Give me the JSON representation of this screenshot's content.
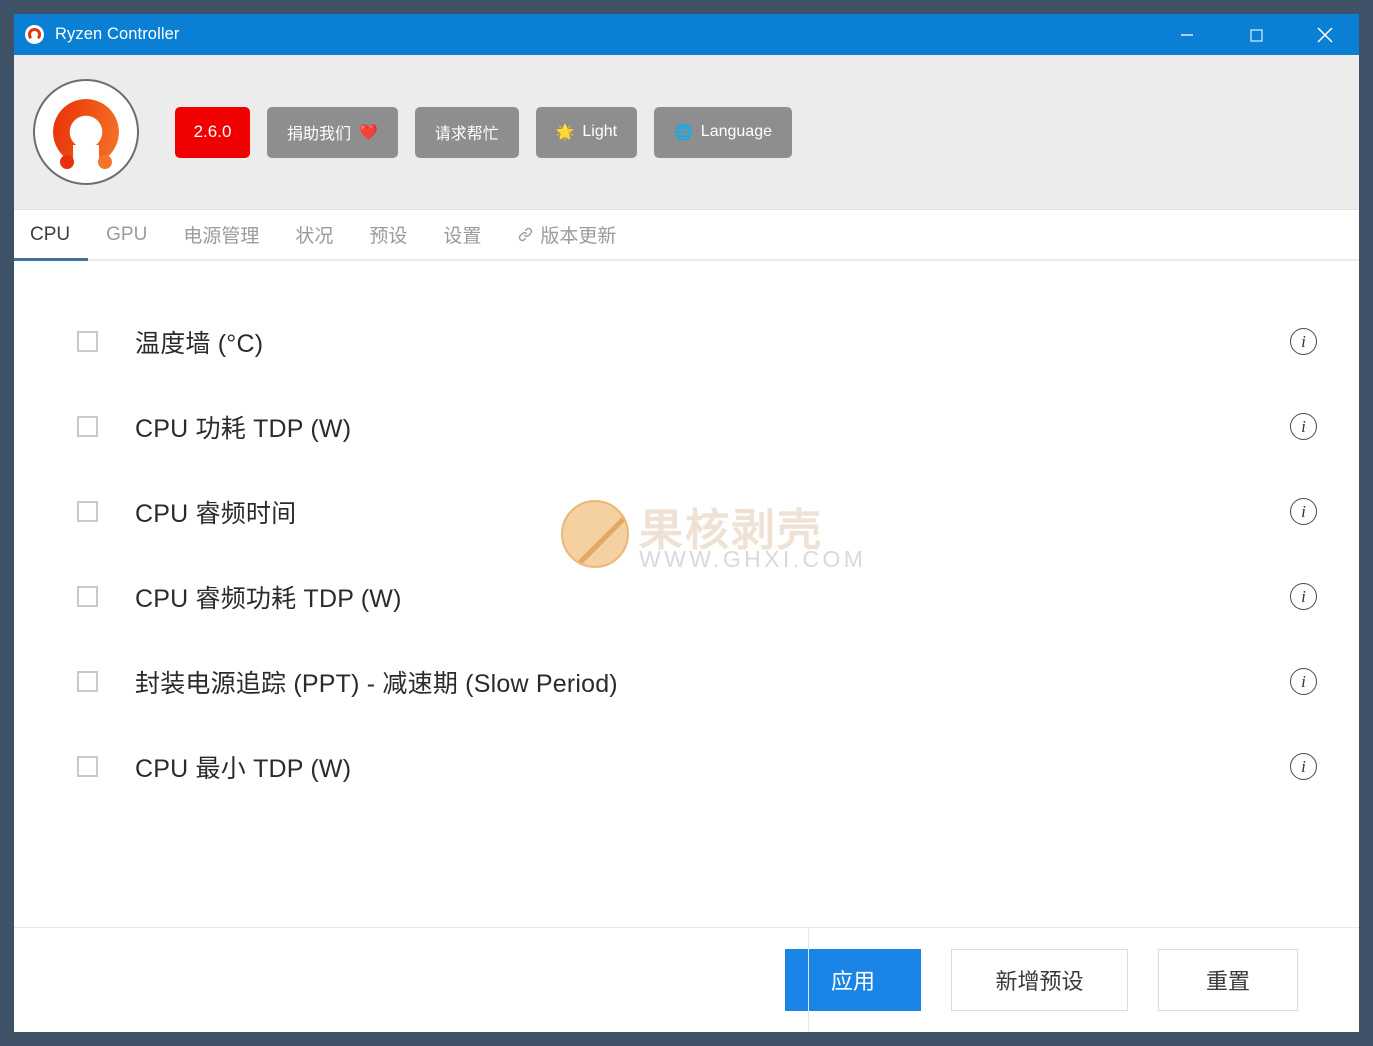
{
  "window": {
    "title": "Ryzen Controller",
    "titlebar_color": "#0a7fd4",
    "frame_color": "#3f5166",
    "controls": {
      "minimize": "minimize-icon",
      "maximize": "maximize-icon",
      "close": "close-icon"
    }
  },
  "header": {
    "logo": "ryzen-controller-logo",
    "version_badge": "2.6.0",
    "version_badge_color": "#f00000",
    "buttons": [
      {
        "label": "捐助我们",
        "icon": "❤️",
        "icon_name": "heart-icon"
      },
      {
        "label": "请求帮忙",
        "icon": "",
        "icon_name": ""
      },
      {
        "label": "Light",
        "icon": "🌟",
        "icon_name": "sun-icon"
      },
      {
        "label": "Language",
        "icon": "🌐",
        "icon_name": "globe-icon"
      }
    ]
  },
  "tabs": [
    {
      "label": "CPU",
      "active": true,
      "icon": ""
    },
    {
      "label": "GPU",
      "active": false,
      "icon": ""
    },
    {
      "label": "电源管理",
      "active": false,
      "icon": ""
    },
    {
      "label": "状况",
      "active": false,
      "icon": ""
    },
    {
      "label": "预设",
      "active": false,
      "icon": ""
    },
    {
      "label": "设置",
      "active": false,
      "icon": ""
    },
    {
      "label": "版本更新",
      "active": false,
      "icon": "link-icon"
    }
  ],
  "tab_accent_color": "#41729c",
  "options": [
    {
      "label": "温度墙 (°C)",
      "checked": false,
      "info": "i"
    },
    {
      "label": "CPU 功耗 TDP (W)",
      "checked": false,
      "info": "i"
    },
    {
      "label": "CPU 睿频时间",
      "checked": false,
      "info": "i"
    },
    {
      "label": "CPU 睿频功耗 TDP (W)",
      "checked": false,
      "info": "i"
    },
    {
      "label": "封装电源追踪 (PPT) - 减速期 (Slow Period)",
      "checked": false,
      "info": "i"
    },
    {
      "label": "CPU 最小 TDP (W)",
      "checked": false,
      "info": "i"
    }
  ],
  "watermark": {
    "text_cn": "果核剥壳",
    "text_url": "WWW.GHXI.COM"
  },
  "footer": {
    "apply_label": "应用",
    "add_preset_label": "新增预设",
    "reset_label": "重置",
    "primary_color": "#1b84e7"
  }
}
